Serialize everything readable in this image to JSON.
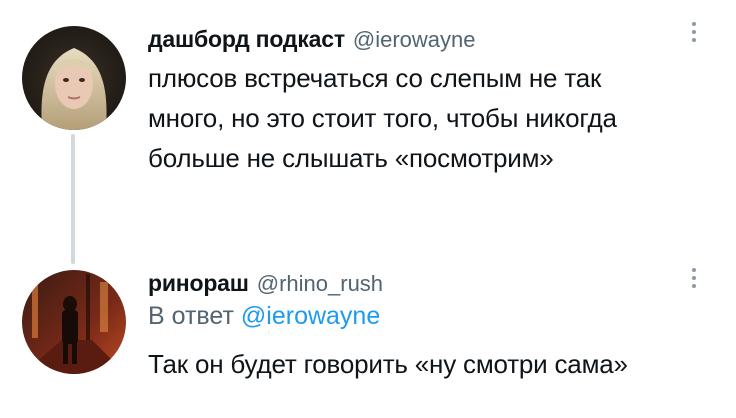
{
  "tweets": [
    {
      "author_name": "дашборд подкаст",
      "handle": "@ierowayne",
      "text_lines": [
        "плюсов встречаться со слепым не так",
        "много, но это стоит того, чтобы никогда",
        "больше не слышать «посмотрим»"
      ]
    },
    {
      "author_name": "ринораш",
      "handle": "@rhino_rush",
      "reply_prefix": "В ответ",
      "reply_mention": "@ierowayne",
      "text_lines": [
        "Так он будет говорить «ну смотри сама»"
      ]
    }
  ],
  "colors": {
    "text": "#0f1419",
    "secondary": "#536471",
    "accent": "#1d9bf0",
    "thread_line": "#cfd9de"
  },
  "icons": {
    "more": "more-vertical-icon"
  }
}
